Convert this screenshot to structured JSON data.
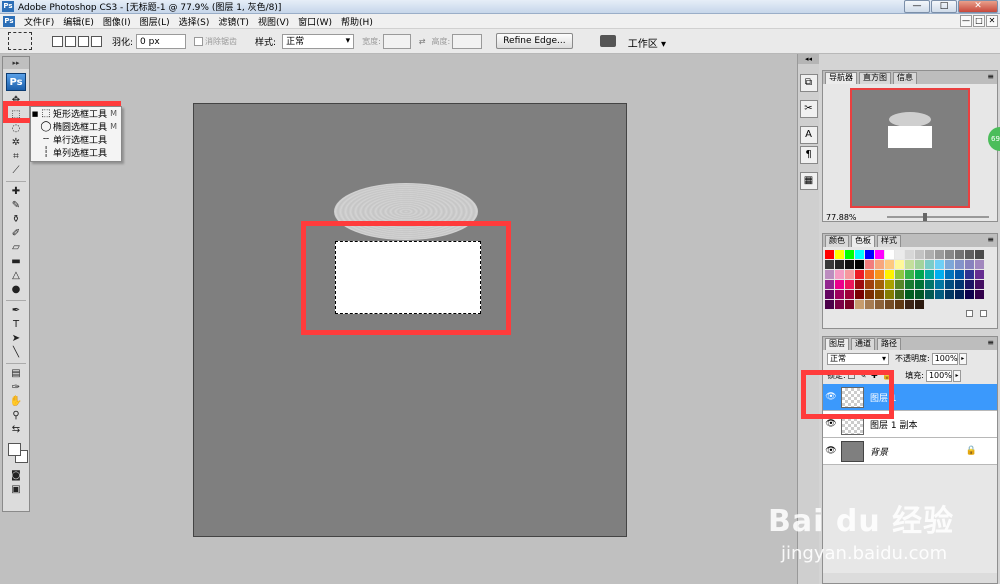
{
  "window": {
    "app_badge": "Ps",
    "title": "Adobe Photoshop CS3 - [无标题-1 @ 77.9% (图层 1, 灰色/8)]",
    "minimize": "—",
    "maximize": "□",
    "close": "✕"
  },
  "menu": {
    "items": [
      "文件(F)",
      "编辑(E)",
      "图像(I)",
      "图层(L)",
      "选择(S)",
      "滤镜(T)",
      "视图(V)",
      "窗口(W)",
      "帮助(H)"
    ]
  },
  "options": {
    "feather_label": "羽化:",
    "feather_value": "0 px",
    "antialias_label": "消除锯齿",
    "style_label": "样式:",
    "style_value": "正常",
    "width_label": "宽度:",
    "height_label": "高度:",
    "refine_edge": "Refine Edge...",
    "workspace": "工作区 ▾"
  },
  "toolbox": {
    "logo": "Ps"
  },
  "flyout": {
    "items": [
      {
        "label": "矩形选框工具",
        "key": "M"
      },
      {
        "label": "椭圆选框工具",
        "key": "M"
      },
      {
        "label": "单行选框工具",
        "key": ""
      },
      {
        "label": "单列选框工具",
        "key": ""
      }
    ]
  },
  "navigator": {
    "tabs": [
      "导航器",
      "直方图",
      "信息"
    ],
    "zoom": "77.88%"
  },
  "swatches_panel": {
    "tabs": [
      "颜色",
      "色板",
      "样式"
    ],
    "colors": [
      "#ff0000",
      "#ffff00",
      "#00ff00",
      "#00ffff",
      "#0000ff",
      "#ff00ff",
      "#ffffff",
      "#ebebeb",
      "#d7d7d7",
      "#c3c3c3",
      "#afafaf",
      "#9b9b9b",
      "#878787",
      "#737373",
      "#5f5f5f",
      "#4b4b4b",
      "#373737",
      "#232323",
      "#0f0f0f",
      "#000000",
      "#f27d7d",
      "#f7a67d",
      "#fdc97f",
      "#fff899",
      "#c4df9b",
      "#a3d39c",
      "#7accc8",
      "#6dcff6",
      "#7da7d8",
      "#8393ca",
      "#8882be",
      "#a187be",
      "#bc8dbf",
      "#f49ac2",
      "#f6989d",
      "#ed1c24",
      "#f26522",
      "#f7941d",
      "#fff200",
      "#8dc63f",
      "#39b54a",
      "#00a651",
      "#00a99d",
      "#00aeef",
      "#0072bc",
      "#0054a6",
      "#2e3192",
      "#662d91",
      "#92278f",
      "#ec008c",
      "#ed145b",
      "#9e0b0f",
      "#a0410d",
      "#a3620a",
      "#aba000",
      "#598527",
      "#197b30",
      "#007236",
      "#00746b",
      "#0076a3",
      "#004b80",
      "#003471",
      "#1b1464",
      "#440e62",
      "#630460",
      "#9e005d",
      "#9e0039",
      "#790000",
      "#7b2e00",
      "#7d4900",
      "#827b00",
      "#406618",
      "#005e20",
      "#005826",
      "#005952",
      "#005b7f",
      "#003663",
      "#002157",
      "#0d004c",
      "#32004b",
      "#4b0049",
      "#7b0046",
      "#7a0026",
      "#c69c6d",
      "#a67c52",
      "#8c6239",
      "#754c24",
      "#603913",
      "#3c2415",
      "#2c1a0f"
    ]
  },
  "layers": {
    "tabs": [
      "图层",
      "通道",
      "路径"
    ],
    "blend_mode": "正常",
    "opacity_label": "不透明度:",
    "opacity_value": "100%",
    "lock_label": "锁定:",
    "lock_icons": "□ ✎ ✚ 🔒",
    "fill_label": "填充:",
    "fill_value": "100%",
    "items": [
      {
        "name": "图层 1",
        "selected": true
      },
      {
        "name": "图层 1 副本",
        "selected": false
      },
      {
        "name": "背景",
        "selected": false
      }
    ]
  },
  "watermark": {
    "logo": "Bai du 经验",
    "url": "jingyan.baidu.com"
  },
  "accent": {
    "red_highlight": "#ff3b3b",
    "layer_selected": "#3b99fc",
    "canvas_gray": "#7f7f7f"
  },
  "badge_text": "69"
}
